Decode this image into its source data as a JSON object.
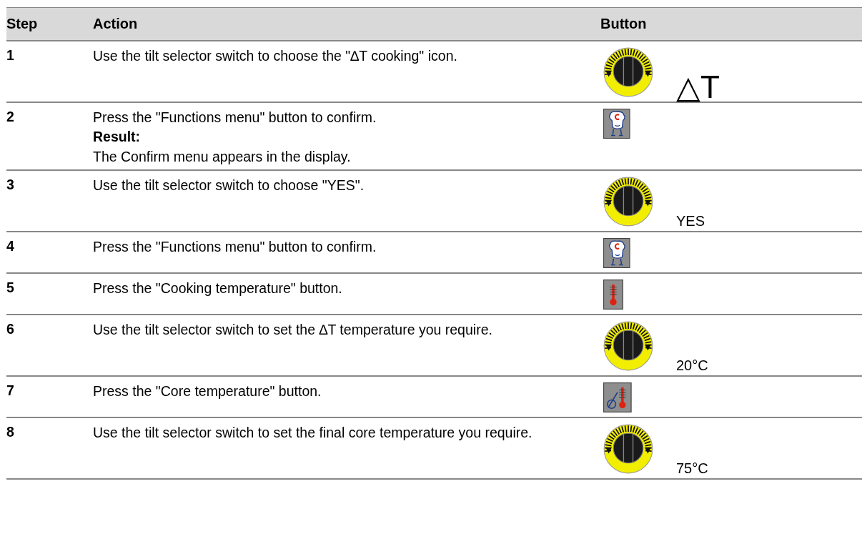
{
  "table": {
    "columns": [
      "Step",
      "Action",
      "Button"
    ],
    "rows": [
      {
        "step": "1",
        "action": "Use the tilt selector switch to choose the \"∆T cooking\" icon.",
        "button": {
          "kind": "dial",
          "caption": "△T",
          "large": true
        }
      },
      {
        "step": "2",
        "action": "Press the \"Functions menu\" button to confirm.",
        "result": {
          "label": "Result:",
          "text": "The Confirm menu appears in the display."
        },
        "button": {
          "kind": "chef"
        }
      },
      {
        "step": "3",
        "action": "Use the tilt selector switch to choose \"YES\".",
        "button": {
          "kind": "dial",
          "caption": "YES",
          "large": false
        }
      },
      {
        "step": "4",
        "action": "Press the \"Functions menu\" button to confirm.",
        "button": {
          "kind": "chef"
        }
      },
      {
        "step": "5",
        "action": "Press the \"Cooking temperature\" button.",
        "button": {
          "kind": "thermo"
        }
      },
      {
        "step": "6",
        "action": "Use the tilt selector switch to set the ∆T temperature you require.",
        "button": {
          "kind": "dial",
          "caption": "20°C",
          "large": false
        }
      },
      {
        "step": "7",
        "action": "Press the \"Core temperature\" button.",
        "button": {
          "kind": "core"
        }
      },
      {
        "step": "8",
        "action": "Use the tilt selector switch to set the final core temperature you require.",
        "button": {
          "kind": "dial",
          "caption": "75°C",
          "large": false
        }
      }
    ]
  }
}
